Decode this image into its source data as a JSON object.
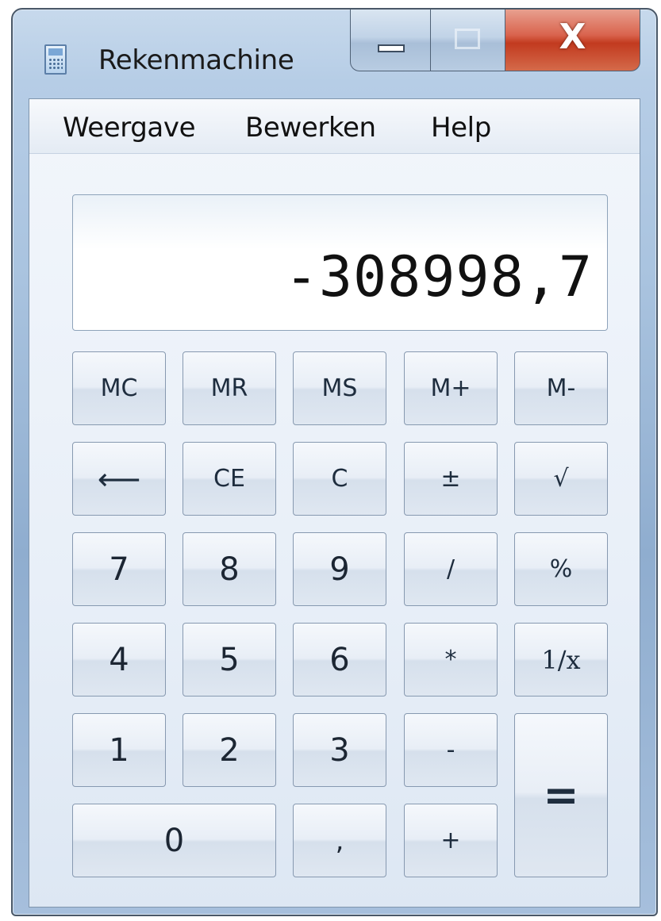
{
  "window": {
    "title": "Rekenmachine",
    "app_icon": "calculator-icon",
    "controls": {
      "minimize": "minimize-icon",
      "maximize": "maximize-icon",
      "close_label": "X"
    }
  },
  "menu": {
    "items": [
      "Weergave",
      "Bewerken",
      "Help"
    ]
  },
  "display": {
    "value": "-308998,7"
  },
  "buttons": {
    "memory": [
      "MC",
      "MR",
      "MS",
      "M+",
      "M-"
    ],
    "edit": [
      "⟵",
      "CE",
      "C",
      "±",
      "√"
    ],
    "row7": [
      "7",
      "8",
      "9",
      "/",
      "%"
    ],
    "row4": [
      "4",
      "5",
      "6",
      "*",
      "1/x"
    ],
    "row1": [
      "1",
      "2",
      "3",
      "-"
    ],
    "equals": "=",
    "row0": [
      "0",
      ",",
      "+"
    ]
  }
}
